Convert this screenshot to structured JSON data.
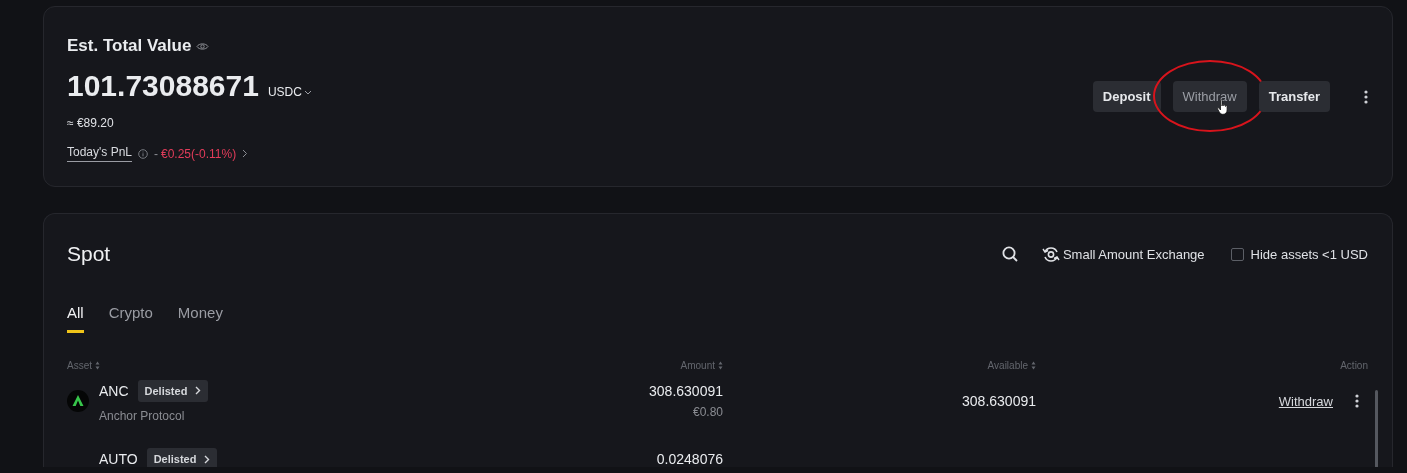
{
  "summary": {
    "title": "Est. Total Value",
    "value": "101.73088671",
    "currency": "USDC",
    "fiat_value": "≈ €89.20",
    "pnl_label": "Today's PnL",
    "pnl_sign": "-",
    "pnl_value": "€0.25(-0.11%)",
    "buttons": [
      {
        "label": "Deposit",
        "hovered": false,
        "circled": false
      },
      {
        "label": "Withdraw",
        "hovered": true,
        "circled": true
      },
      {
        "label": "Transfer",
        "hovered": false,
        "circled": false
      }
    ]
  },
  "spot": {
    "title": "Spot",
    "small_amount_exchange": "Small Amount Exchange",
    "hide_small": {
      "label": "Hide assets <1 USD",
      "checked": false
    },
    "tabs": [
      {
        "label": "All",
        "selected": true
      },
      {
        "label": "Crypto",
        "selected": false
      },
      {
        "label": "Money",
        "selected": false
      }
    ],
    "columns": [
      "Asset",
      "Amount",
      "Available",
      "Action"
    ],
    "rows": [
      {
        "symbol": "ANC",
        "badge": "Delisted",
        "name": "Anchor Protocol",
        "amount": "308.630091",
        "amount_fiat": "€0.80",
        "available": "308.630091",
        "action": "Withdraw"
      },
      {
        "symbol": "AUTO",
        "badge": "Delisted",
        "amount": "0.0248076"
      }
    ]
  }
}
